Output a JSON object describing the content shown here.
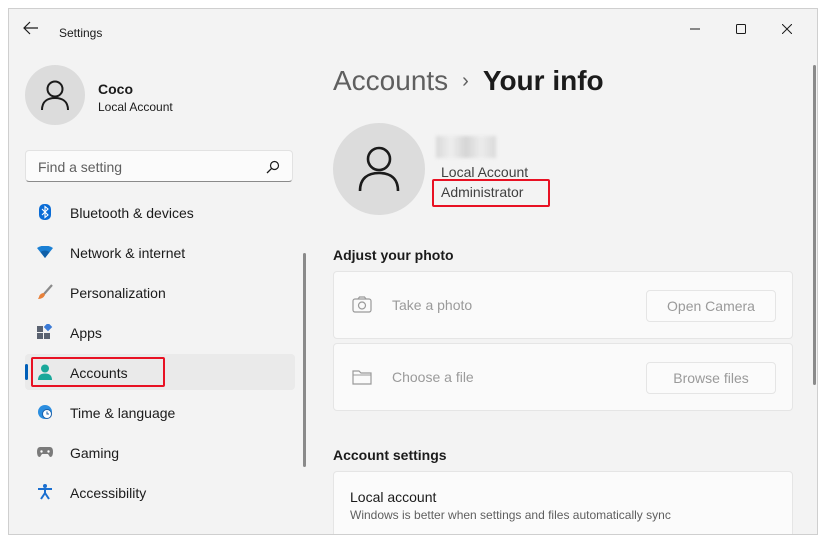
{
  "titlebar": {
    "title": "Settings"
  },
  "profile": {
    "name": "Coco",
    "account_type": "Local Account"
  },
  "search": {
    "placeholder": "Find a setting"
  },
  "nav": {
    "items": [
      {
        "label": "Bluetooth & devices",
        "icon": "bluetooth-icon"
      },
      {
        "label": "Network & internet",
        "icon": "wifi-icon"
      },
      {
        "label": "Personalization",
        "icon": "brush-icon"
      },
      {
        "label": "Apps",
        "icon": "apps-icon"
      },
      {
        "label": "Accounts",
        "icon": "account-icon",
        "selected": true
      },
      {
        "label": "Time & language",
        "icon": "globe-clock-icon"
      },
      {
        "label": "Gaming",
        "icon": "gamepad-icon"
      },
      {
        "label": "Accessibility",
        "icon": "accessibility-icon"
      }
    ]
  },
  "breadcrumb": {
    "parent": "Accounts",
    "separator": "›",
    "current": "Your info"
  },
  "user_info": {
    "account_type": "Local Account",
    "role": "Administrator"
  },
  "adjust_photo": {
    "title": "Adjust your photo",
    "take_photo": {
      "label": "Take a photo",
      "button": "Open Camera"
    },
    "choose_file": {
      "label": "Choose a file",
      "button": "Browse files"
    }
  },
  "account_settings": {
    "title": "Account settings",
    "local_account": {
      "title": "Local account",
      "description": "Windows is better when settings and files automatically sync"
    }
  },
  "colors": {
    "accent": "#005fb8",
    "highlight": "#e81123",
    "window_bg": "#f3f3f3"
  }
}
